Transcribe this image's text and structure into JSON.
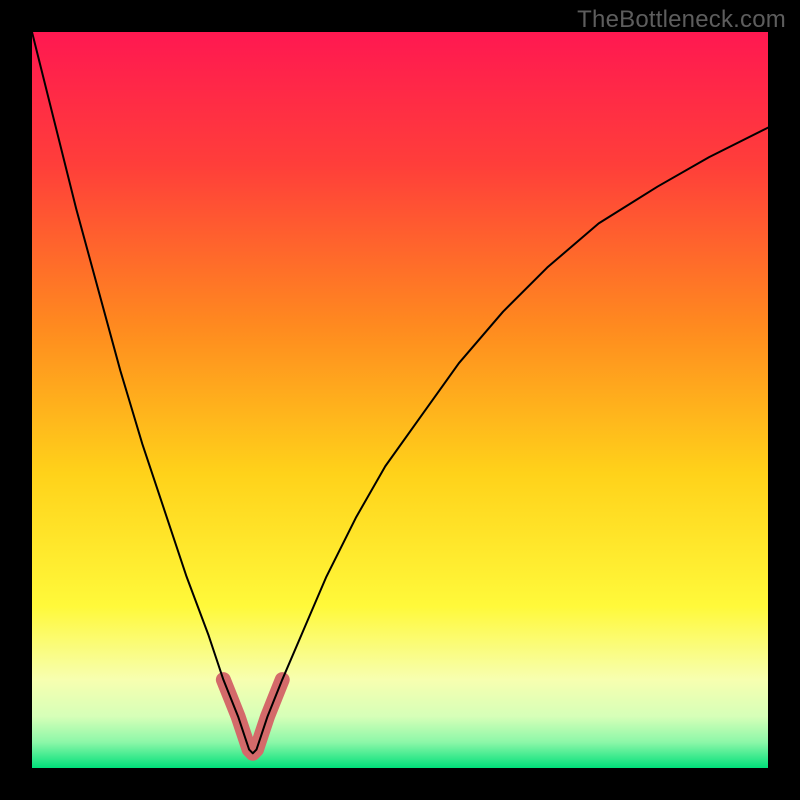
{
  "watermark": "TheBottleneck.com",
  "colors": {
    "frame": "#000000",
    "gradient_stops": [
      {
        "offset": 0.0,
        "color": "#ff1851"
      },
      {
        "offset": 0.18,
        "color": "#ff3e3a"
      },
      {
        "offset": 0.4,
        "color": "#ff8a1f"
      },
      {
        "offset": 0.6,
        "color": "#ffd21a"
      },
      {
        "offset": 0.78,
        "color": "#fff93a"
      },
      {
        "offset": 0.88,
        "color": "#f7ffb0"
      },
      {
        "offset": 0.93,
        "color": "#d6ffb8"
      },
      {
        "offset": 0.965,
        "color": "#8cf7a8"
      },
      {
        "offset": 1.0,
        "color": "#00e07a"
      }
    ],
    "curve": "#000000",
    "highlight": "#d46a6a"
  },
  "chart_data": {
    "type": "line",
    "title": "",
    "xlabel": "",
    "ylabel": "",
    "xlim": [
      0,
      100
    ],
    "ylim": [
      0,
      100
    ],
    "grid": false,
    "legend": false,
    "series": [
      {
        "name": "bottleneck-curve",
        "x": [
          0,
          3,
          6,
          9,
          12,
          15,
          18,
          21,
          24,
          26,
          28,
          29,
          29.5,
          30,
          30.5,
          31,
          32,
          34,
          37,
          40,
          44,
          48,
          53,
          58,
          64,
          70,
          77,
          85,
          92,
          100
        ],
        "y": [
          100,
          88,
          76,
          65,
          54,
          44,
          35,
          26,
          18,
          12,
          7,
          4,
          2.5,
          2,
          2.5,
          4,
          7,
          12,
          19,
          26,
          34,
          41,
          48,
          55,
          62,
          68,
          74,
          79,
          83,
          87
        ]
      },
      {
        "name": "highlight-band",
        "x": [
          26,
          27,
          28,
          29,
          29.5,
          30,
          30.5,
          31,
          32,
          33,
          34
        ],
        "y": [
          12,
          9.5,
          7,
          4,
          2.5,
          2,
          2.5,
          4,
          7,
          9.5,
          12
        ]
      }
    ],
    "annotations": {
      "watermark": "TheBottleneck.com"
    }
  }
}
